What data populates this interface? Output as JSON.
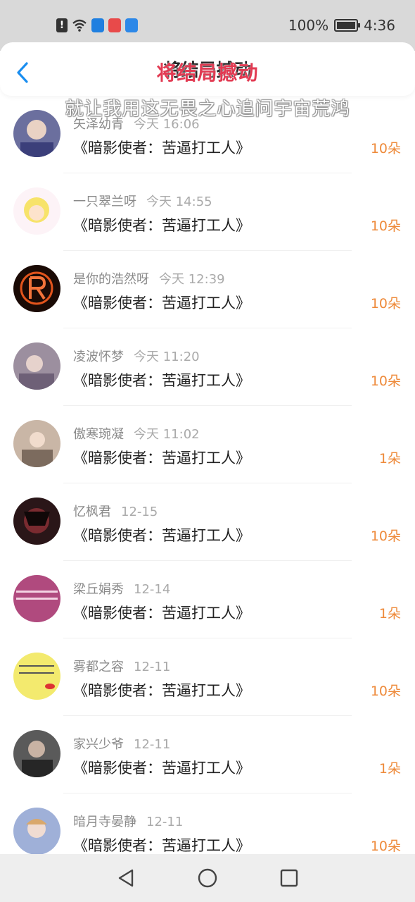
{
  "status_bar": {
    "battery": "100%",
    "time": "4:36",
    "alert_glyph": "!"
  },
  "header": {
    "title": "将结局撼动"
  },
  "overlay": {
    "title": "将结局撼动",
    "subtitle": "就让我用这无畏之心追问宇宙荒鸿"
  },
  "rows": [
    {
      "name": "矢泽幼青",
      "time": "今天 16:06",
      "gift": "《暗影使者：苦逼打工人》",
      "count": "10朵",
      "avatar_color": "#6b6f9e"
    },
    {
      "name": "一只翠兰呀",
      "time": "今天 14:55",
      "gift": "《暗影使者：苦逼打工人》",
      "count": "10朵",
      "avatar_color": "#f7e36a"
    },
    {
      "name": "是你的浩然呀",
      "time": "今天 12:39",
      "gift": "《暗影使者：苦逼打工人》",
      "count": "10朵",
      "avatar_color": "#1a0a05"
    },
    {
      "name": "凌波怀梦",
      "time": "今天 11:20",
      "gift": "《暗影使者：苦逼打工人》",
      "count": "10朵",
      "avatar_color": "#8b7b8b"
    },
    {
      "name": "傲寒琬凝",
      "time": "今天 11:02",
      "gift": "《暗影使者：苦逼打工人》",
      "count": "1朵",
      "avatar_color": "#c9b6a6"
    },
    {
      "name": "忆枫君",
      "time": "12-15",
      "gift": "《暗影使者：苦逼打工人》",
      "count": "10朵",
      "avatar_color": "#2a1618"
    },
    {
      "name": "梁丘娟秀",
      "time": "12-14",
      "gift": "《暗影使者：苦逼打工人》",
      "count": "1朵",
      "avatar_color": "#b04a7e"
    },
    {
      "name": "雾都之容",
      "time": "12-11",
      "gift": "《暗影使者：苦逼打工人》",
      "count": "10朵",
      "avatar_color": "#f3ea6e"
    },
    {
      "name": "家兴少爷",
      "time": "12-11",
      "gift": "《暗影使者：苦逼打工人》",
      "count": "1朵",
      "avatar_color": "#3c3c3c"
    },
    {
      "name": "暗月寺晏静",
      "time": "12-11",
      "gift": "《暗影使者：苦逼打工人》",
      "count": "10朵",
      "avatar_color": "#9fb0d8"
    }
  ],
  "colors": {
    "accent": "#1a8ef0",
    "count": "#ee8a3a",
    "overlay_title": "#e23a52"
  },
  "icons": {
    "back": "back-chevron-icon",
    "nav_back": "triangle-back-icon",
    "nav_home": "circle-home-icon",
    "nav_recent": "square-recent-icon"
  }
}
